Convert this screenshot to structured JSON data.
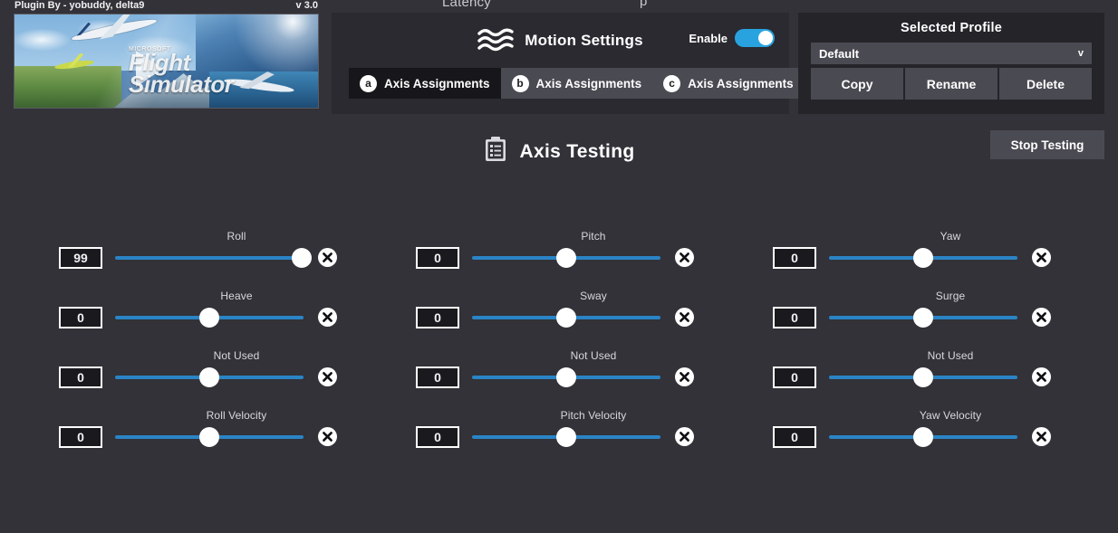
{
  "top_cut_labels": {
    "left": "Latency",
    "right": "p"
  },
  "splash": {
    "credit": "Plugin By - yobuddy, delta9",
    "version": "v 3.0",
    "image_alt": "Microsoft Flight Simulator",
    "wordmark_micro": "MICROSOFT",
    "wordmark_line1": "Flight",
    "wordmark_line2": "Simulator",
    "play_icon": "play-triangle-icon"
  },
  "motion": {
    "title": "Motion Settings",
    "icon": "waves-icon",
    "enable_label": "Enable",
    "enable_on": true,
    "tabs": [
      {
        "badge": "a",
        "label": "Axis Assignments",
        "selected": true
      },
      {
        "badge": "b",
        "label": "Axis Assignments",
        "selected": false
      },
      {
        "badge": "c",
        "label": "Axis Assignments",
        "selected": false
      }
    ]
  },
  "profile": {
    "title": "Selected Profile",
    "selected": "Default",
    "chevron": "v",
    "buttons": [
      "Copy",
      "Rename",
      "Delete"
    ]
  },
  "testing": {
    "title": "Axis Testing",
    "icon": "clipboard-list-icon",
    "stop_label": "Stop Testing"
  },
  "colors": {
    "background": "#323238",
    "panel": "#2a2a30",
    "panel_alt": "#242429",
    "accent_blue": "#2a84c6",
    "toggle_on": "#29a3e0",
    "button": "#4a4a52",
    "value_box": "#1a1a1e"
  },
  "axes": [
    {
      "label": "Roll",
      "value": "99",
      "percent": 99,
      "clear_icon": "close-circle-icon"
    },
    {
      "label": "Pitch",
      "value": "0",
      "percent": 50,
      "clear_icon": "close-circle-icon"
    },
    {
      "label": "Yaw",
      "value": "0",
      "percent": 50,
      "clear_icon": "close-circle-icon"
    },
    {
      "label": "Heave",
      "value": "0",
      "percent": 50,
      "clear_icon": "close-circle-icon"
    },
    {
      "label": "Sway",
      "value": "0",
      "percent": 50,
      "clear_icon": "close-circle-icon"
    },
    {
      "label": "Surge",
      "value": "0",
      "percent": 50,
      "clear_icon": "close-circle-icon"
    },
    {
      "label": "Not Used",
      "value": "0",
      "percent": 50,
      "clear_icon": "close-circle-icon"
    },
    {
      "label": "Not Used",
      "value": "0",
      "percent": 50,
      "clear_icon": "close-circle-icon"
    },
    {
      "label": "Not Used",
      "value": "0",
      "percent": 50,
      "clear_icon": "close-circle-icon"
    },
    {
      "label": "Roll Velocity",
      "value": "0",
      "percent": 50,
      "clear_icon": "close-circle-icon"
    },
    {
      "label": "Pitch Velocity",
      "value": "0",
      "percent": 50,
      "clear_icon": "close-circle-icon"
    },
    {
      "label": "Yaw Velocity",
      "value": "0",
      "percent": 50,
      "clear_icon": "close-circle-icon"
    }
  ]
}
